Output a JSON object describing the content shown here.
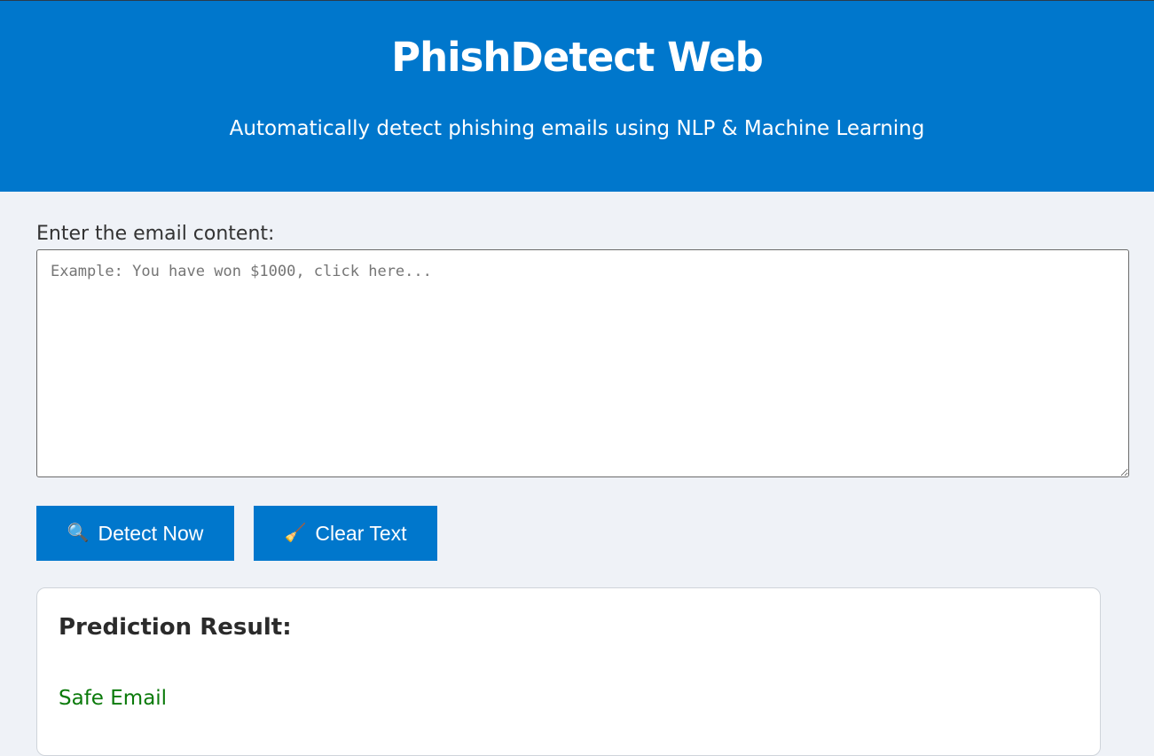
{
  "header": {
    "title": "PhishDetect Web",
    "subtitle": "Automatically detect phishing emails using NLP & Machine Learning"
  },
  "form": {
    "label": "Enter the email content:",
    "input_value": "",
    "input_placeholder": "Example: You have won $1000, click here...",
    "detect_button": {
      "icon": "magnifier-icon",
      "glyph": "🔍",
      "label": "Detect Now"
    },
    "clear_button": {
      "icon": "broom-icon",
      "glyph": "🧹",
      "label": "Clear Text"
    }
  },
  "result": {
    "heading": "Prediction Result:",
    "value": "Safe Email",
    "value_color": "#0a7a0a"
  },
  "colors": {
    "accent": "#0077cc",
    "background": "#eff2f7"
  }
}
